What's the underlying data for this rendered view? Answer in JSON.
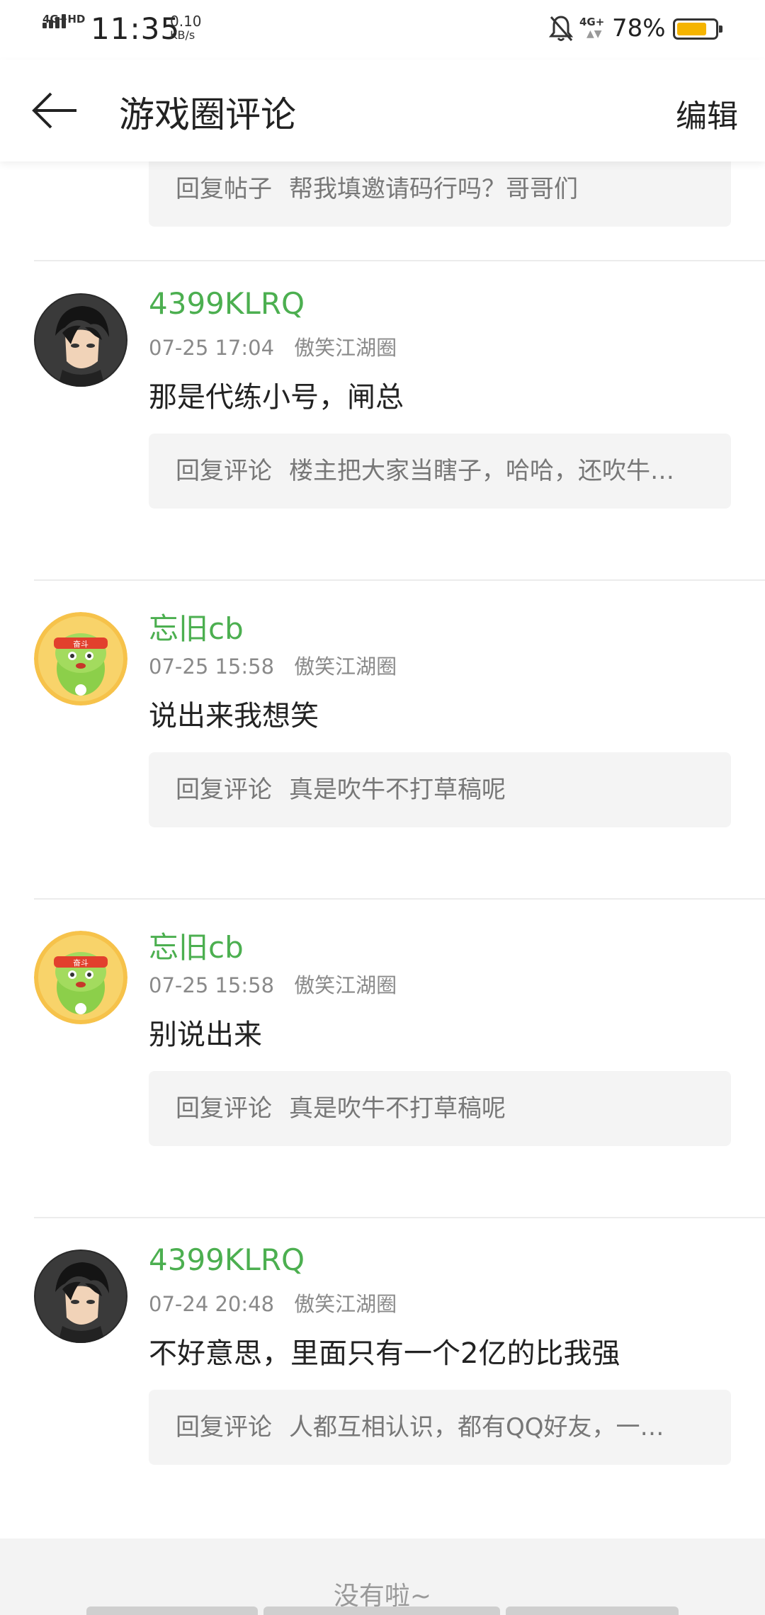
{
  "status_bar": {
    "network": "4G+HD",
    "time": "11:35",
    "speed": "0.10",
    "speed_unit": "KB/s",
    "network2": "4G+",
    "battery_pct": "78%",
    "battery_level": 0.78,
    "battery_color": "#f5b400"
  },
  "header": {
    "back_icon": "back-arrow-icon",
    "title": "游戏圈评论",
    "edit_label": "编辑"
  },
  "top_quote": {
    "kind": "回复帖子",
    "text": "帮我填邀请码行吗？哥哥们"
  },
  "comments": [
    {
      "user": "4399KLRQ",
      "avatar": "anime-boy-avatar",
      "time": "07-25 17:04",
      "circle": "傲笑江湖圈",
      "text": "那是代练小号，闸总",
      "quote_kind": "回复评论",
      "quote_text": "楼主把大家当瞎子，哈哈，还吹牛…"
    },
    {
      "user": "忘旧cb",
      "avatar": "green-mascot-avatar",
      "time": "07-25 15:58",
      "circle": "傲笑江湖圈",
      "text": "说出来我想笑",
      "quote_kind": "回复评论",
      "quote_text": "真是吹牛不打草稿呢"
    },
    {
      "user": "忘旧cb",
      "avatar": "green-mascot-avatar",
      "time": "07-25 15:58",
      "circle": "傲笑江湖圈",
      "text": "别说出来",
      "quote_kind": "回复评论",
      "quote_text": "真是吹牛不打草稿呢"
    },
    {
      "user": "4399KLRQ",
      "avatar": "anime-boy-avatar",
      "time": "07-24 20:48",
      "circle": "傲笑江湖圈",
      "text": "不好意思，里面只有一个2亿的比我强",
      "quote_kind": "回复评论",
      "quote_text": "人都互相认识，都有QQ好友，一…"
    }
  ],
  "footer": {
    "text": "没有啦~"
  },
  "colors": {
    "username": "#4caf50",
    "quote_bg": "#f4f4f4"
  }
}
